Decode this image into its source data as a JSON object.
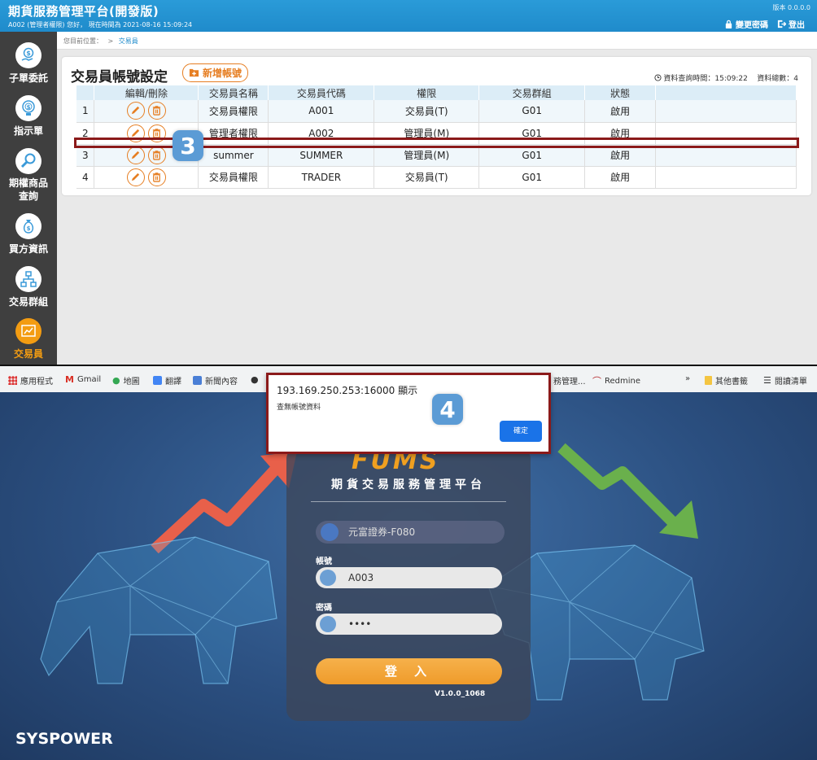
{
  "header": {
    "title": "期貨服務管理平台(開發版)",
    "sub": "A002 (管理者權限)   您好，  現在時間為   2021-08-16 15:09:24",
    "version": "版本 0.0.0.0",
    "change_password": "變更密碼",
    "logout": "登出"
  },
  "sidebar": {
    "items": [
      {
        "label": "子單委託",
        "icon": "dollar-hand-icon"
      },
      {
        "label": "指示單",
        "icon": "dollar-bulb-icon"
      },
      {
        "label": "期權商品查詢",
        "line1": "期權商品",
        "line2": "查詢",
        "icon": "search-icon"
      },
      {
        "label": "買方資訊",
        "icon": "money-bag-icon"
      },
      {
        "label": "交易群組",
        "icon": "org-chart-icon"
      },
      {
        "label": "交易員",
        "icon": "trader-icon"
      }
    ]
  },
  "breadcrumb": {
    "prefix": "您目前位置：",
    "sep": ">",
    "current": "交易員"
  },
  "panel": {
    "title": "交易員帳號設定",
    "add_button": "新增帳號",
    "query_info": "資料查詢時間：15:09:22    資料總數：4"
  },
  "table": {
    "headers": [
      "",
      "編輯/刪除",
      "交易員名稱",
      "交易員代碼",
      "權限",
      "交易群組",
      "狀態",
      ""
    ],
    "rows": [
      {
        "no": "1",
        "name": "交易員權限",
        "code": "A001",
        "perm": "交易員(T)",
        "group": "G01",
        "status": "啟用"
      },
      {
        "no": "2",
        "name": "管理者權限",
        "code": "A002",
        "perm": "管理員(M)",
        "group": "G01",
        "status": "啟用"
      },
      {
        "no": "3",
        "name": "summer",
        "code": "SUMMER",
        "perm": "管理員(M)",
        "group": "G01",
        "status": "啟用"
      },
      {
        "no": "4",
        "name": "交易員權限",
        "code": "TRADER",
        "perm": "交易員(T)",
        "group": "G01",
        "status": "啟用"
      }
    ]
  },
  "badges": {
    "step3": "3",
    "step4": "4"
  },
  "bookmarks": {
    "apps": "應用程式",
    "gmail": "Gmail",
    "maps": "地圖",
    "translate": "翻譯",
    "news": "新聞內容",
    "partial": "務管理...",
    "redmine": "Redmine",
    "more": "»",
    "other": "其他書籤",
    "reading": "閱讀清單"
  },
  "dialog": {
    "title": "193.169.250.253:16000 顯示",
    "message": "查無帳號資料",
    "ok": "確定"
  },
  "login": {
    "logo": "FUMS",
    "platform_name": "期貨交易服務管理平台",
    "broker": "元富證券-F080",
    "account_label": "帳號",
    "account_value": "A003",
    "password_label": "密碼",
    "password_value": "••••",
    "submit": "登 入",
    "version": "V1.0.0_1068",
    "brand": "SYSPOWER"
  },
  "colors": {
    "header_blue": "#1f8bcb",
    "sidebar": "#3f3f3f",
    "accent_orange": "#e67e22",
    "highlight_red": "#8b1a1a",
    "badge_blue": "#5b9bd5"
  }
}
